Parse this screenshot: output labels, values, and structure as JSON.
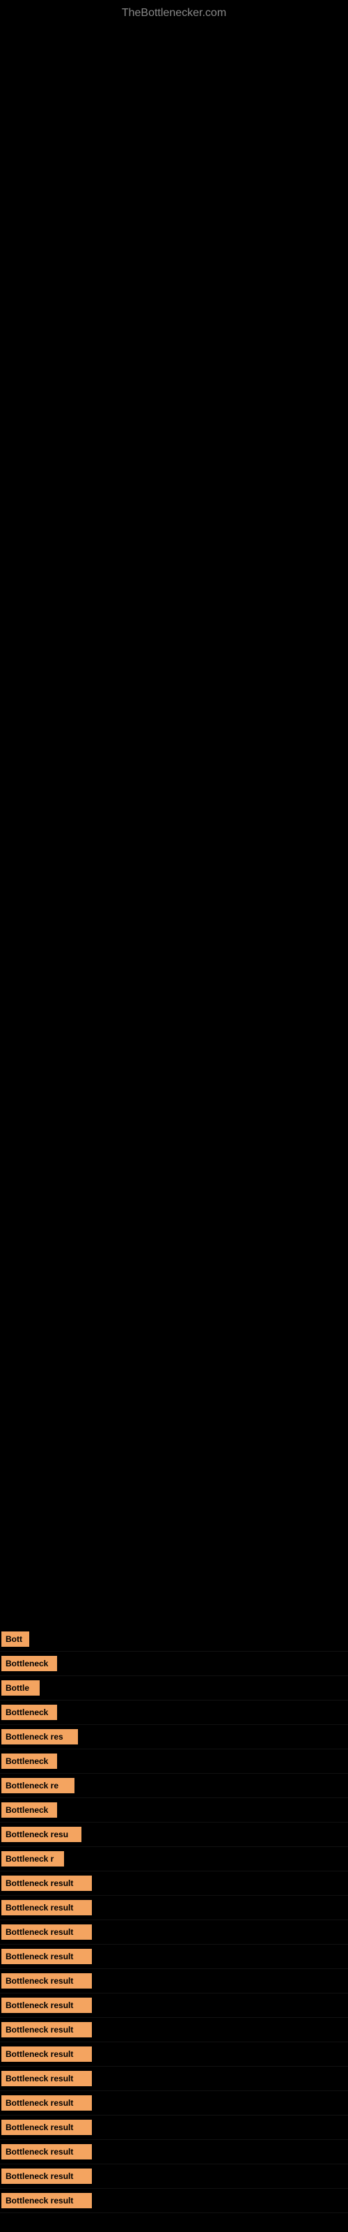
{
  "site": {
    "title": "TheBottlenecker.com"
  },
  "results": [
    {
      "label": "Bott",
      "width": 40
    },
    {
      "label": "Bottleneck",
      "width": 80
    },
    {
      "label": "Bottle",
      "width": 55
    },
    {
      "label": "Bottleneck",
      "width": 80
    },
    {
      "label": "Bottleneck res",
      "width": 110
    },
    {
      "label": "Bottleneck",
      "width": 80
    },
    {
      "label": "Bottleneck re",
      "width": 105
    },
    {
      "label": "Bottleneck",
      "width": 80
    },
    {
      "label": "Bottleneck resu",
      "width": 115
    },
    {
      "label": "Bottleneck r",
      "width": 90
    },
    {
      "label": "Bottleneck result",
      "width": 130
    },
    {
      "label": "Bottleneck result",
      "width": 130
    },
    {
      "label": "Bottleneck result",
      "width": 130
    },
    {
      "label": "Bottleneck result",
      "width": 130
    },
    {
      "label": "Bottleneck result",
      "width": 130
    },
    {
      "label": "Bottleneck result",
      "width": 130
    },
    {
      "label": "Bottleneck result",
      "width": 130
    },
    {
      "label": "Bottleneck result",
      "width": 130
    },
    {
      "label": "Bottleneck result",
      "width": 130
    },
    {
      "label": "Bottleneck result",
      "width": 130
    },
    {
      "label": "Bottleneck result",
      "width": 130
    },
    {
      "label": "Bottleneck result",
      "width": 130
    },
    {
      "label": "Bottleneck result",
      "width": 130
    },
    {
      "label": "Bottleneck result",
      "width": 130
    }
  ]
}
